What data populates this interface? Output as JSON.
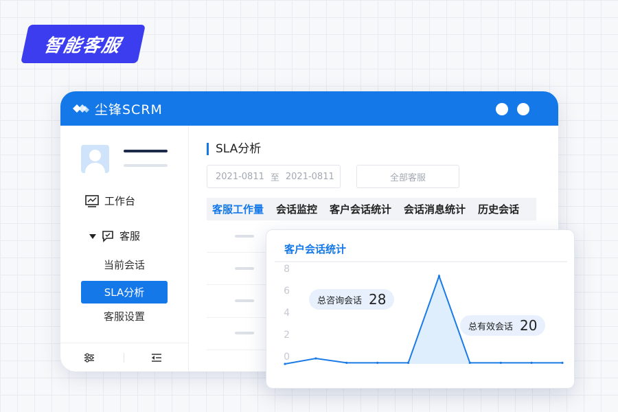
{
  "badge": {
    "label": "智能客服"
  },
  "window": {
    "brand": "尘锋SCRM"
  },
  "sidebar": {
    "nav_workbench": "工作台",
    "nav_service": "客服",
    "sub_items": [
      "当前会话",
      "SLA分析",
      "客服设置"
    ]
  },
  "main": {
    "title": "SLA分析",
    "date_start": "2021-0811",
    "date_sep": "至",
    "date_end": "2021-0811",
    "agent_select": "全部客服",
    "tabs": [
      "客服工作量",
      "会话监控",
      "客户会话统计",
      "会话消息统计",
      "历史会话"
    ]
  },
  "chart_card": {
    "title": "客户会话统计",
    "stat1_label": "总咨询会话",
    "stat1_value": "28",
    "stat2_label": "总有效会话",
    "stat2_value": "20"
  },
  "chart_data": {
    "type": "area",
    "y_ticks": [
      "8",
      "6",
      "4",
      "2",
      "0"
    ],
    "ylim": [
      0,
      8
    ],
    "values": [
      0.0,
      0.5,
      0.1,
      0.1,
      0.1,
      8.0,
      0.1,
      0.1,
      0.1,
      0.1
    ],
    "grid": false,
    "colors": {
      "line": "#1a7ae6",
      "fill": "#dfeefd"
    }
  }
}
